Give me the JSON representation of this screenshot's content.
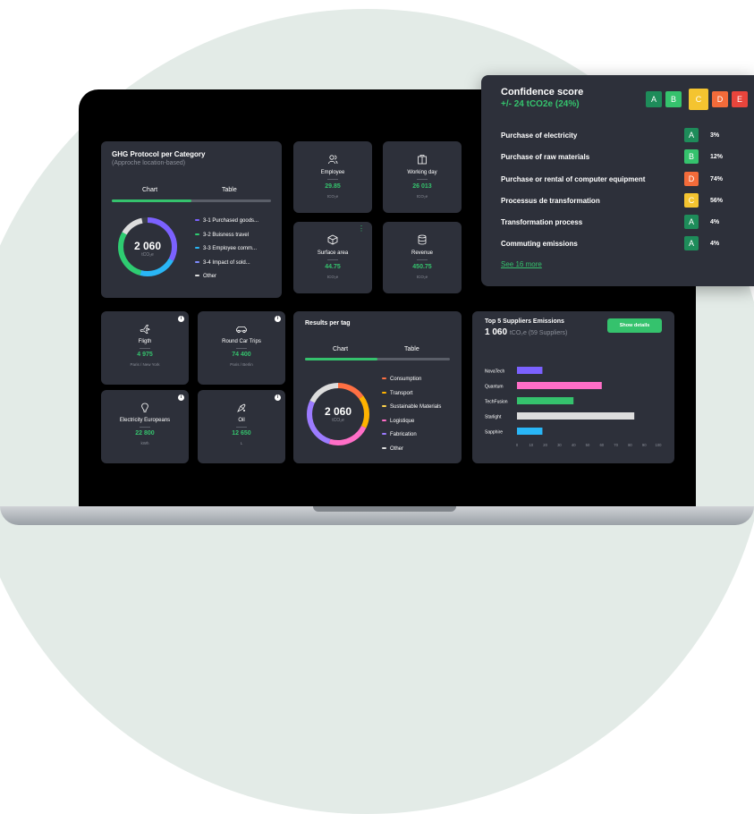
{
  "ghg": {
    "title": "GHG Protocol per Category",
    "subtitle": "(Approche location-based)",
    "tab_chart": "Chart",
    "tab_table": "Table",
    "total": "2 060",
    "unit": "tCO₂e",
    "legend": [
      {
        "label": "3-1 Purchased goods...",
        "color": "#7b61ff"
      },
      {
        "label": "3-2 Buisness travel",
        "color": "#2ecc71"
      },
      {
        "label": "3-3 Employee comm...",
        "color": "#29b6f6"
      },
      {
        "label": "3-4 Impact of sold...",
        "color": "#7e8cff"
      },
      {
        "label": "Other",
        "color": "#dddddd"
      }
    ]
  },
  "kpis": [
    {
      "icon": "users-icon",
      "label": "Employee",
      "value": "29.85",
      "unit": "tCO₂e"
    },
    {
      "icon": "calendar-icon",
      "label": "Working day",
      "value": "26 013",
      "unit": "tCO₂e"
    },
    {
      "icon": "cube-icon",
      "label": "Surface area",
      "value": "44.75",
      "unit": "tCO₂e"
    },
    {
      "icon": "database-icon",
      "label": "Revenue",
      "value": "450.75",
      "unit": "tCO₂e"
    }
  ],
  "stats": [
    {
      "icon": "plane-icon",
      "label": "Fligth",
      "value": "4 975",
      "unit": "Paris / New York"
    },
    {
      "icon": "car-icon",
      "label": "Round Car Trips",
      "value": "74 400",
      "unit": "Paris / Berlin"
    },
    {
      "icon": "bulb-icon",
      "label": "Electricity Europeans",
      "value": "22 800",
      "unit": "kWh"
    },
    {
      "icon": "oil-icon",
      "label": "Oil",
      "value": "12 650",
      "unit": "L"
    }
  ],
  "info_glyph": "i",
  "kebab_glyph": "⋮",
  "results": {
    "title": "Results per tag",
    "tab_chart": "Chart",
    "tab_table": "Table",
    "total": "2 060",
    "unit": "tCO₂e",
    "legend": [
      {
        "label": "Consumption",
        "color": "#ff7043"
      },
      {
        "label": "Transport",
        "color": "#ffb300"
      },
      {
        "label": "Sustainable Materials",
        "color": "#ffd54f"
      },
      {
        "label": "Logistique",
        "color": "#ff6ec7"
      },
      {
        "label": "Fabrication",
        "color": "#9c7bff"
      },
      {
        "label": "Other",
        "color": "#dddddd"
      }
    ]
  },
  "suppliers": {
    "title": "Top 5 Suppliers Emissions",
    "total": "1 060",
    "total_unit": "tCO₂e (59 Suppliers)",
    "button": "Show details"
  },
  "chart_data": {
    "type": "bar",
    "orientation": "horizontal",
    "categories": [
      "NovaTech",
      "Quantum",
      "TechFusion",
      "Starlight",
      "Sapphire"
    ],
    "values": [
      18,
      60,
      40,
      83,
      18
    ],
    "colors": [
      "#7b61ff",
      "#ff6ec7",
      "#35c26d",
      "#dddddd",
      "#29b6f6"
    ],
    "xlim": [
      0,
      100
    ],
    "xticks": [
      0,
      10,
      20,
      30,
      40,
      50,
      60,
      70,
      80,
      90,
      100
    ]
  },
  "confidence": {
    "title": "Confidence score",
    "delta": "+/- 24 tCO2e  (24%)",
    "grades": [
      {
        "letter": "A",
        "color": "#1e8c5a"
      },
      {
        "letter": "B",
        "color": "#35c26d"
      },
      {
        "letter": "C",
        "color": "#f4c430"
      },
      {
        "letter": "D",
        "color": "#f26b3a"
      },
      {
        "letter": "E",
        "color": "#e8453c"
      }
    ],
    "rows": [
      {
        "label": "Purchase of electricity",
        "grade": "A",
        "color": "#1e8c5a",
        "pct": "3%"
      },
      {
        "label": "Purchase of raw materials",
        "grade": "B",
        "color": "#35c26d",
        "pct": "12%"
      },
      {
        "label": "Purchase or rental of computer equipment",
        "grade": "D",
        "color": "#f26b3a",
        "pct": "74%"
      },
      {
        "label": "Processus de transformation",
        "grade": "C",
        "color": "#f4c430",
        "pct": "56%"
      },
      {
        "label": "Transformation process",
        "grade": "A",
        "color": "#1e8c5a",
        "pct": "4%"
      },
      {
        "label": "Commuting emissions",
        "grade": "A",
        "color": "#1e8c5a",
        "pct": "4%"
      }
    ],
    "see_more": "See 16 more"
  }
}
